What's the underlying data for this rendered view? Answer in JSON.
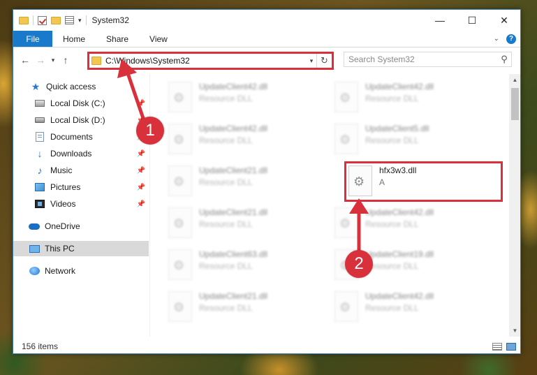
{
  "window": {
    "title": "System32",
    "controls": {
      "minimize": "—",
      "maximize": "☐",
      "close": "✕"
    }
  },
  "ribbon": {
    "tabs": [
      "File",
      "Home",
      "Share",
      "View"
    ],
    "help": "?"
  },
  "address": {
    "path": "C:\\Windows\\System32",
    "search_placeholder": "Search System32"
  },
  "nav": {
    "items": [
      {
        "label": "Quick access",
        "icon": "star-icon",
        "pinned": false
      },
      {
        "label": "Local Disk (C:)",
        "icon": "drive-icon",
        "pinned": true
      },
      {
        "label": "Local Disk (D:)",
        "icon": "drive-icon",
        "pinned": true
      },
      {
        "label": "Documents",
        "icon": "documents-icon",
        "pinned": true
      },
      {
        "label": "Downloads",
        "icon": "downloads-icon",
        "pinned": true
      },
      {
        "label": "Music",
        "icon": "music-icon",
        "pinned": true
      },
      {
        "label": "Pictures",
        "icon": "pictures-icon",
        "pinned": true
      },
      {
        "label": "Videos",
        "icon": "videos-icon",
        "pinned": true
      },
      {
        "label": "OneDrive",
        "icon": "cloud-icon",
        "pinned": false
      },
      {
        "label": "This PC",
        "icon": "pc-icon",
        "pinned": false,
        "selected": true
      },
      {
        "label": "Network",
        "icon": "network-icon",
        "pinned": false
      }
    ]
  },
  "files": {
    "left": [
      {
        "name": "UpdateClient42.dll",
        "type": "Resource DLL"
      },
      {
        "name": "UpdateClient42.dll",
        "type": "Resource DLL"
      },
      {
        "name": "UpdateClient21.dll",
        "type": "Resource DLL"
      },
      {
        "name": "UpdateClient21.dll",
        "type": "Resource DLL"
      },
      {
        "name": "UpdateClient63.dll",
        "type": "Resource DLL"
      },
      {
        "name": "UpdateClient21.dll",
        "type": "Resource DLL"
      }
    ],
    "right": [
      {
        "name": "UpdateClient42.dll",
        "type": "Resource DLL"
      },
      {
        "name": "UpdateClient5.dll",
        "type": "Resource DLL"
      },
      {
        "name": "hfx3w3.dll",
        "type": "A",
        "highlighted": true
      },
      {
        "name": "UpdateClient42.dll",
        "type": "Resource DLL"
      },
      {
        "name": "UpdateClient19.dll",
        "type": "Resource DLL"
      },
      {
        "name": "UpdateClient42.dll",
        "type": "Resource DLL"
      }
    ]
  },
  "status": {
    "item_count": "156 items"
  },
  "annotations": {
    "step1": "1",
    "step2": "2",
    "color": "#d9313b"
  }
}
